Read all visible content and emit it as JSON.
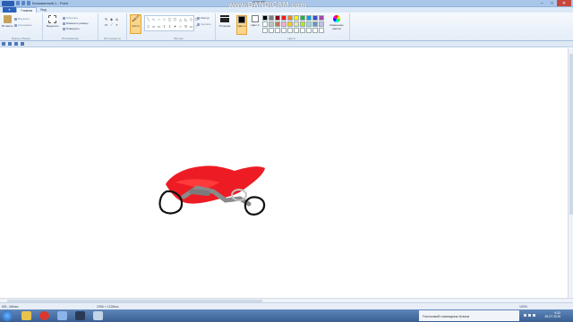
{
  "window": {
    "title": "Безымянный.1 - Paint"
  },
  "tabs": {
    "file": "",
    "home": "Главная",
    "view": "Вид"
  },
  "ribbon": {
    "clipboard": {
      "paste": "Вставить",
      "cut": "Вырезать",
      "copy": "Копировать",
      "label": "Буфер обмена"
    },
    "image": {
      "select": "Выделить",
      "crop": "Обрезать",
      "resize": "Изменить размер",
      "rotate": "Повернуть",
      "label": "Изображение"
    },
    "tools": {
      "label": "Инструменты",
      "text_glyph": "A"
    },
    "brushes": {
      "label": "Кисти"
    },
    "shapes": {
      "outline": "Контур",
      "fill": "Заливка",
      "label": "Фигуры"
    },
    "thickness": {
      "label": "Толщина"
    },
    "colors": {
      "color1": "Цвет 1",
      "color2": "Цвет 2",
      "edit": "Изменение цветов",
      "label": "Цвета"
    }
  },
  "palette": [
    "#000000",
    "#7f7f7f",
    "#880015",
    "#ed1c24",
    "#ff7f27",
    "#fff200",
    "#22b14c",
    "#00a2e8",
    "#3f48cc",
    "#a349a4",
    "#ffffff",
    "#c3c3c3",
    "#b97a57",
    "#ffaec9",
    "#ffc90e",
    "#efe4b0",
    "#b5e61d",
    "#99d9ea",
    "#7092be",
    "#c8bfe7",
    "#ffffff",
    "#ffffff",
    "#ffffff",
    "#ffffff",
    "#ffffff",
    "#ffffff",
    "#ffffff",
    "#ffffff",
    "#ffffff",
    "#ffffff"
  ],
  "selected_colors": {
    "color1": "#000000",
    "color2": "#ffffff"
  },
  "watermark": {
    "text": "www.BANDICAM.com",
    "resolution": "1920x1080"
  },
  "status": {
    "cursor": "651, 466пкс",
    "canvas_size": "2056 × 1128пкс",
    "zoom": "100%"
  },
  "taskbar": {
    "search": "Голосовой помощник Алиса",
    "time": "9:32",
    "date": "26.07.2019"
  }
}
